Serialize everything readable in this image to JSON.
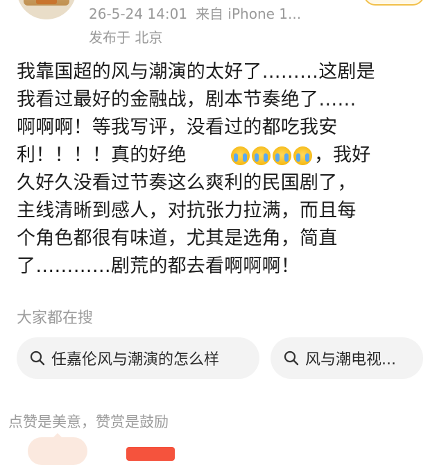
{
  "post": {
    "timestamp": "26-5-24 14:01",
    "source": "来自 iPhone 1...",
    "location": "发布于 北京",
    "lines": {
      "l1": "我靠国超的风与潮演的太好了………这剧是",
      "l2": "我看过最好的金融战，剧本节奏绝了……",
      "l3": "啊啊啊！等我写评，没看过的都吃我安",
      "l4a": "利！！！！真的好绝",
      "l4b": "，我好",
      "l5": "久好久没看过节奏这么爽利的民国剧了，",
      "l6": "主线清晰到感人，对抗张力拉满，而且每",
      "l7": "个角色都很有味道，尤其是选角，简直",
      "l8": "了…………剧荒的都去看啊啊啊！"
    },
    "emojis": [
      "crying-emoji",
      "crying-emoji",
      "crying-emoji",
      "crying-emoji"
    ]
  },
  "search": {
    "label": "大家都在搜",
    "chips": [
      {
        "text": "任嘉伦风与潮演的怎么样",
        "icon": "search-icon"
      },
      {
        "text": "风与潮电视...",
        "icon": "search-icon"
      }
    ]
  },
  "reward": {
    "text": "点赞是美意，赞赏是鼓励"
  },
  "colors": {
    "meta_gray": "#9a9a9a",
    "chip_bg": "#f3f3f3",
    "accent_red": "#f5533d",
    "emoji_yellow": "#f5b917"
  }
}
